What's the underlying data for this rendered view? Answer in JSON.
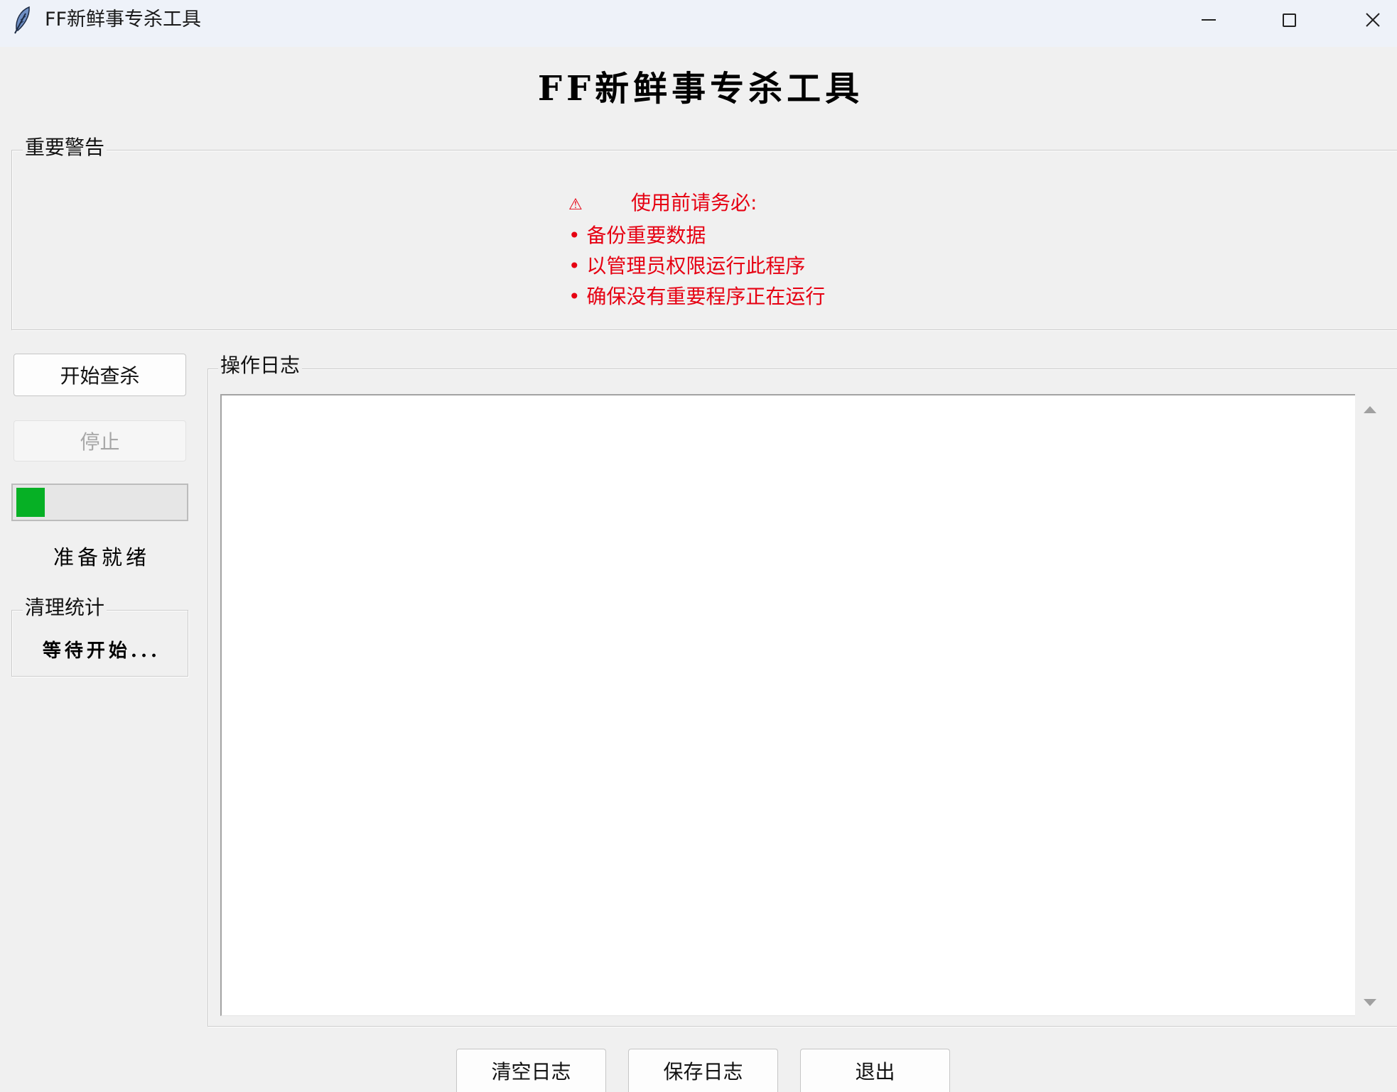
{
  "window": {
    "title": "FF新鲜事专杀工具",
    "icons": {
      "app": "feather-icon",
      "minimize": "minimize-icon",
      "maximize": "maximize-icon",
      "close": "close-icon"
    }
  },
  "header": {
    "title": "FF新鲜事专杀工具"
  },
  "warning": {
    "frame_label": "重要警告",
    "heading_icon": "⚠",
    "heading": "使用前请务必:",
    "items": [
      "• 备份重要数据",
      "• 以管理员权限运行此程序",
      "• 确保没有重要程序正在运行"
    ]
  },
  "controls": {
    "start_button": "开始查杀",
    "stop_button": "停止",
    "stop_disabled": true,
    "progress": {
      "fraction": 0.17
    },
    "status": "准备就绪"
  },
  "stats": {
    "frame_label": "清理统计",
    "text": "等待开始..."
  },
  "log": {
    "frame_label": "操作日志",
    "entries": [],
    "scroll_icons": {
      "up": "scroll-up-arrow-icon",
      "down": "scroll-down-arrow-icon"
    }
  },
  "footer": {
    "clear_button": "清空日志",
    "save_button": "保存日志",
    "exit_button": "退出"
  },
  "colors": {
    "warning_text": "#e60012",
    "progress_fill": "#06b025",
    "titlebar_bg": "#eef2f9",
    "window_bg": "#f0f0f0"
  }
}
